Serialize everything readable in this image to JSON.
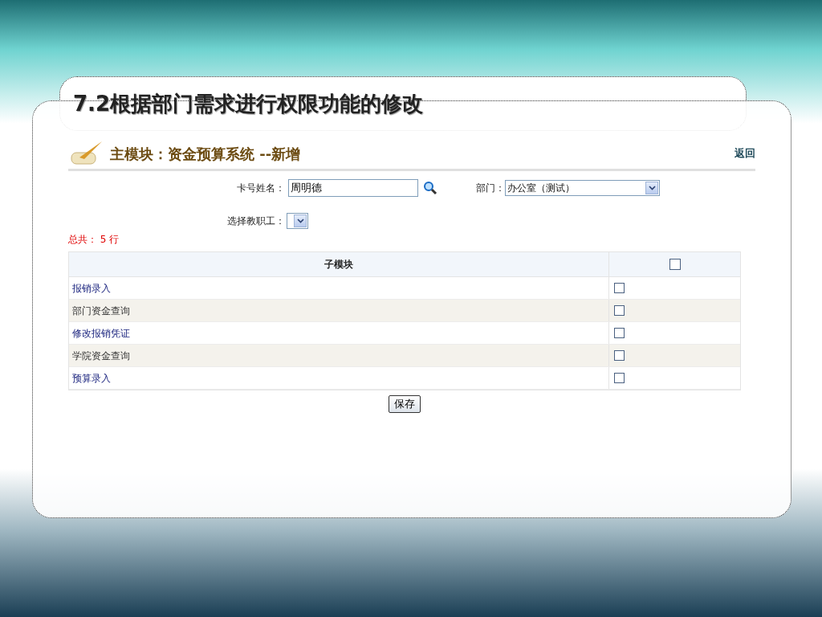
{
  "slide_title": "7.2根据部门需求进行权限功能的修改",
  "header": {
    "title": "主模块：资金预算系统 --新增",
    "back_link": "返回"
  },
  "form": {
    "card_name_label": "卡号姓名：",
    "card_name_value": "周明德",
    "department_label": "部门：",
    "department_value": "办公室（测试）",
    "staff_label": "选择教职工："
  },
  "total": "总共： 5 行",
  "table": {
    "columns": [
      "子模块"
    ],
    "select_all_checked": false,
    "rows": [
      {
        "name": "报销录入",
        "checked": false
      },
      {
        "name": "部门资金查询",
        "checked": false
      },
      {
        "name": "修改报销凭证",
        "checked": false
      },
      {
        "name": "学院资金查询",
        "checked": false
      },
      {
        "name": "预算录入",
        "checked": false
      }
    ]
  },
  "save_button": "保存"
}
